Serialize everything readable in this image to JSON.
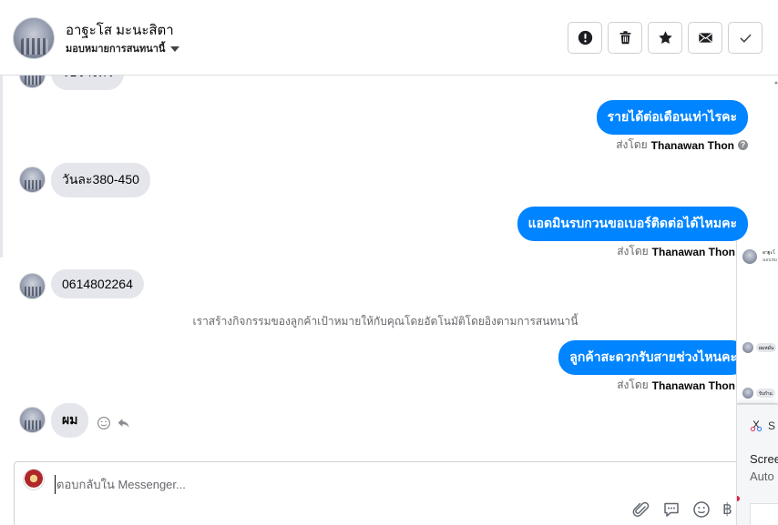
{
  "header": {
    "contact_name": "อาฐะโส มะนะสิตา",
    "assign_label": "มอบหมายการสนทนานี้",
    "buttons": [
      {
        "name": "spam-button",
        "icon": "exclamation-icon"
      },
      {
        "name": "delete-button",
        "icon": "trash-icon"
      },
      {
        "name": "star-button",
        "icon": "star-icon"
      },
      {
        "name": "mark-unread-button",
        "icon": "envelope-icon"
      },
      {
        "name": "mark-done-button",
        "icon": "check-icon"
      }
    ]
  },
  "messages": {
    "partial_top_text": "รับจ้างทั่ว",
    "m1_text": "รายได้ต่อเดือนเท่าไรคะ",
    "m1_sentby_prefix": "ส่งโดย",
    "m1_sentby_name": "Thanawan Thon",
    "m2_text": "วันละ380-450",
    "m3_text": "แอดมินรบกวนขอเบอร์ติดต่อได้ไหมคะ",
    "m3_sentby_prefix": "ส่งโดย",
    "m3_sentby_name": "Thanawan Thon",
    "m4_text": "0614802264",
    "system_note": "เราสร้างกิจกรรมของลูกค้าเป้าหมายให้กับคุณโดยอัตโนมัติโดยอิงตามการสนทนานี้",
    "m5_text": "ลูกค้าสะดวกรับสายช่วงไหนคะ",
    "m5_sentby_prefix": "ส่งโดย",
    "m5_sentby_name": "Thanawan Thon",
    "m6_text": "ผม"
  },
  "composer": {
    "placeholder": "ตอบกลับใน Messenger..."
  },
  "overlay": {
    "mini_header_text": "อาฐะโ",
    "mini_sub_text": "มอบหม",
    "mini_pill1": "ผมหมั่น",
    "mini_pill2": "รับกำแ",
    "snip_label": "S",
    "line1": "Scree",
    "line2": "Auto"
  },
  "colors": {
    "accent_blue": "#0084ff",
    "incoming_bubble": "#e4e6eb",
    "muted_text": "#65676b"
  }
}
